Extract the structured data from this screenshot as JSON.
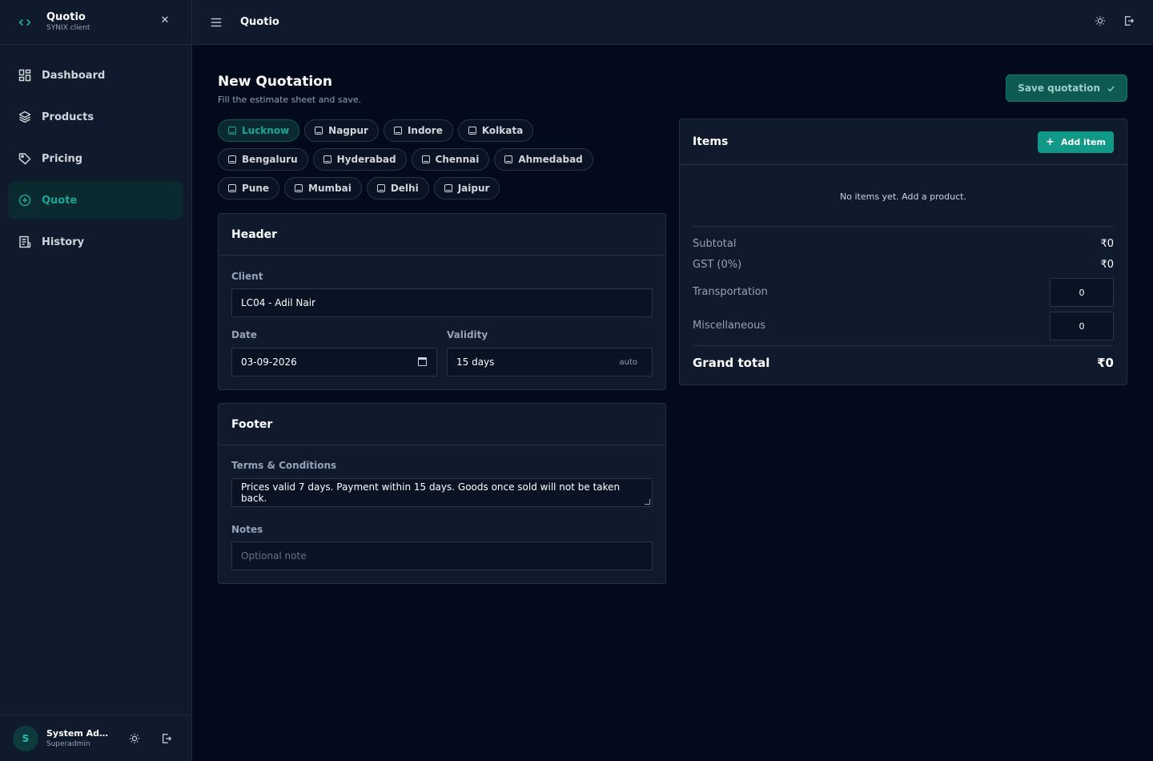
{
  "app": {
    "title": "Quotio",
    "subtitle": "SYNIX client"
  },
  "sidebar": {
    "items": [
      {
        "label": "Dashboard",
        "icon": "dashboard-icon",
        "active": false
      },
      {
        "label": "Products",
        "icon": "layers-icon",
        "active": false
      },
      {
        "label": "Pricing",
        "icon": "tag-icon",
        "active": false
      },
      {
        "label": "Quote",
        "icon": "plus-circle-icon",
        "active": true
      },
      {
        "label": "History",
        "icon": "document-list-icon",
        "active": false
      }
    ],
    "user": {
      "initial": "S",
      "name": "System Admi...",
      "role": "Superadmin"
    }
  },
  "topbar": {
    "title": "Quotio"
  },
  "page": {
    "title": "New Quotation",
    "subtitle": "Fill the estimate sheet and save.",
    "save_label": "Save quotation"
  },
  "locations": [
    "Lucknow",
    "Nagpur",
    "Indore",
    "Kolkata",
    "Bengaluru",
    "Hyderabad",
    "Chennai",
    "Ahmedabad",
    "Pune",
    "Mumbai",
    "Delhi",
    "Jaipur"
  ],
  "active_location": "Lucknow",
  "header_card": {
    "title": "Header",
    "client_label": "Client",
    "client_value": "LC04 - Adil Nair",
    "date_label": "Date",
    "date_value": "03-09-2026",
    "validity_label": "Validity",
    "validity_value": "15 days",
    "validity_tag": "auto"
  },
  "footer_card": {
    "title": "Footer",
    "terms_label": "Terms & Conditions",
    "terms_value": "Prices valid 7 days. Payment within 15 days. Goods once sold will not be taken back.",
    "notes_label": "Notes",
    "notes_placeholder": "Optional note"
  },
  "items_card": {
    "title": "Items",
    "add_label": "Add item",
    "empty_text": "No items yet. Add a product.",
    "subtotal_label": "Subtotal",
    "subtotal_value": "₹0",
    "gst_label": "GST (0%)",
    "gst_value": "₹0",
    "transport_label": "Transportation",
    "transport_value": "0",
    "misc_label": "Miscellaneous",
    "misc_value": "0",
    "grand_label": "Grand total",
    "grand_value": "₹0"
  },
  "colors": {
    "accent": "#0f9986",
    "background": "#030a1c",
    "panel": "#0f1a2c"
  }
}
